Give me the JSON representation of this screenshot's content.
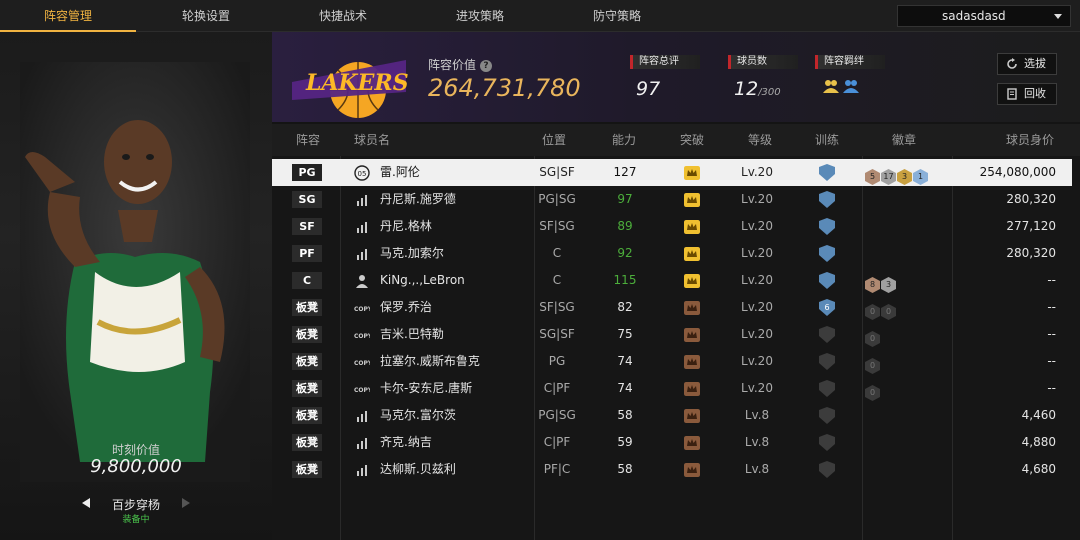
{
  "nav": {
    "tabs": [
      "阵容管理",
      "轮换设置",
      "快捷战术",
      "进攻策略",
      "防守策略"
    ],
    "active_index": 0,
    "user": "sadasdasd"
  },
  "left": {
    "value_label": "时刻价值",
    "value": "9,800,000",
    "skill_name": "百步穿杨",
    "skill_status": "装备中"
  },
  "header": {
    "lineup_value_label": "阵容价值",
    "lineup_value": "264,731,780",
    "rating_label": "阵容总评",
    "rating": "97",
    "players_label": "球员数",
    "players_count": "12",
    "players_max": "/300",
    "bond_label": "阵容羁绊",
    "btn_select": "选拔",
    "btn_recycle": "回收"
  },
  "table": {
    "headers": {
      "slot": "阵容",
      "name": "球员名",
      "position": "位置",
      "ability": "能力",
      "breakthrough": "突破",
      "level": "等级",
      "training": "训练",
      "badges": "徽章",
      "value": "球员身价"
    },
    "rows": [
      {
        "slot": "PG",
        "icon": "05",
        "name": "雷.阿伦",
        "position": "SG|SF",
        "ability": "127",
        "ability_color": "white",
        "break": "gold",
        "level": "Lv.20",
        "train": "",
        "badges": [
          "5",
          "17",
          "3",
          "1"
        ],
        "value": "254,080,000"
      },
      {
        "slot": "SG",
        "icon": "bars",
        "name": "丹尼斯.施罗德",
        "position": "PG|SG",
        "ability": "97",
        "ability_color": "green",
        "break": "gold",
        "level": "Lv.20",
        "train": "",
        "badges": [],
        "value": "280,320"
      },
      {
        "slot": "SF",
        "icon": "bars",
        "name": "丹尼.格林",
        "position": "SF|SG",
        "ability": "89",
        "ability_color": "green",
        "break": "gold",
        "level": "Lv.20",
        "train": "",
        "badges": [],
        "value": "277,120"
      },
      {
        "slot": "PF",
        "icon": "bars",
        "name": "马克.加索尔",
        "position": "C",
        "ability": "92",
        "ability_color": "green",
        "break": "gold",
        "level": "Lv.20",
        "train": "",
        "badges": [],
        "value": "280,320"
      },
      {
        "slot": "C",
        "icon": "person",
        "name": "KiNg.,.,LeBron",
        "position": "C",
        "ability": "115",
        "ability_color": "green",
        "break": "gold",
        "level": "Lv.20",
        "train": "",
        "badges": [
          "8",
          "3"
        ],
        "value": "--"
      },
      {
        "slot": "板凳",
        "icon": "COPY",
        "name": "保罗.乔治",
        "position": "SF|SG",
        "ability": "82",
        "ability_color": "white",
        "break": "bronze",
        "level": "Lv.20",
        "train": "6",
        "badges": [
          "0",
          "0"
        ],
        "value": "--"
      },
      {
        "slot": "板凳",
        "icon": "COPY",
        "name": "吉米.巴特勒",
        "position": "SG|SF",
        "ability": "75",
        "ability_color": "white",
        "break": "bronze",
        "level": "Lv.20",
        "train": "",
        "badges": [
          "0"
        ],
        "value": "--"
      },
      {
        "slot": "板凳",
        "icon": "COPY",
        "name": "拉塞尔.威斯布鲁克",
        "position": "PG",
        "ability": "74",
        "ability_color": "white",
        "break": "bronze",
        "level": "Lv.20",
        "train": "",
        "badges": [
          "0"
        ],
        "value": "--"
      },
      {
        "slot": "板凳",
        "icon": "COPY",
        "name": "卡尔-安东尼.唐斯",
        "position": "C|PF",
        "ability": "74",
        "ability_color": "white",
        "break": "bronze",
        "level": "Lv.20",
        "train": "",
        "badges": [
          "0"
        ],
        "value": "--"
      },
      {
        "slot": "板凳",
        "icon": "bars",
        "name": "马克尔.富尔茨",
        "position": "PG|SG",
        "ability": "58",
        "ability_color": "white",
        "break": "bronze",
        "level": "Lv.8",
        "train": "",
        "badges": [],
        "value": "4,460"
      },
      {
        "slot": "板凳",
        "icon": "bars",
        "name": "齐克.纳吉",
        "position": "C|PF",
        "ability": "59",
        "ability_color": "white",
        "break": "bronze",
        "level": "Lv.8",
        "train": "",
        "badges": [],
        "value": "4,880"
      },
      {
        "slot": "板凳",
        "icon": "bars",
        "name": "达柳斯.贝兹利",
        "position": "PF|C",
        "ability": "58",
        "ability_color": "white",
        "break": "bronze",
        "level": "Lv.8",
        "train": "",
        "badges": [],
        "value": "4,680"
      }
    ]
  },
  "colors": {
    "accent": "#f0b341",
    "green": "#4cae3b",
    "lakers_purple": "#552583",
    "lakers_gold": "#fdb927"
  }
}
